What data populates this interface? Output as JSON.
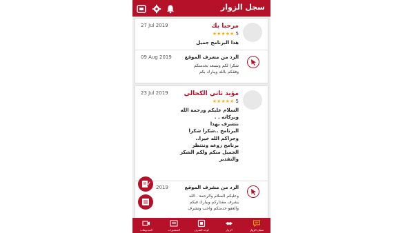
{
  "app": {
    "title": "سجل الزوار"
  },
  "colors": {
    "brand": "#b5122a",
    "star": "#f1b20f",
    "background": "#ececec"
  },
  "top_bar": {
    "icons": [
      "video-icon",
      "gear-icon",
      "bell-icon"
    ]
  },
  "entries": [
    {
      "name": "مرحبا بك",
      "date": "27 Jul 2019",
      "rating": "5",
      "stars": "★★★★★",
      "message": [
        "هذا البرنامج جميل"
      ],
      "reply": {
        "title": "الرد من مشرف الموقع",
        "date": "09 Aug 2019",
        "body": [
          "شكرا لكم ونسعد بخدمتكم",
          "وفقكم بالله ويبارك بكم"
        ]
      }
    },
    {
      "name": "مؤيد ثاني الكحالي",
      "date": "23 Jul 2019",
      "rating": "5",
      "stars": "★★★★★",
      "message": [
        "السلام عليكم ورحمة الله",
        "وبركاته . .",
        "نتشرف بهذا",
        "البرنامج ..شكرا شكرا",
        "وجزاكم الله خيرا..",
        "برنامج روعه وننتظر",
        "الجميل منكم ولكم الشكر",
        "والتقدير"
      ],
      "reply": {
        "title": "الرد من مشرف الموقع",
        "date": "2019",
        "body": [
          "وعليكم السلام والرحمة . الله",
          "يشرف مقداركم ويبارك فيكم",
          "والعفو خدمتكم واجب وتشرف"
        ]
      }
    }
  ],
  "bottom_nav": [
    {
      "label": "سجل الزوار",
      "icon": "chat-icon",
      "active": true
    },
    {
      "label": "الزوار",
      "icon": "handshake-icon",
      "active": false
    },
    {
      "label": "لوحه الشرف",
      "icon": "frame-icon",
      "active": false
    },
    {
      "label": "المنشورات",
      "icon": "newspaper-icon",
      "active": false
    },
    {
      "label": "الفيديوهات",
      "icon": "video-camera-icon",
      "active": false
    }
  ]
}
